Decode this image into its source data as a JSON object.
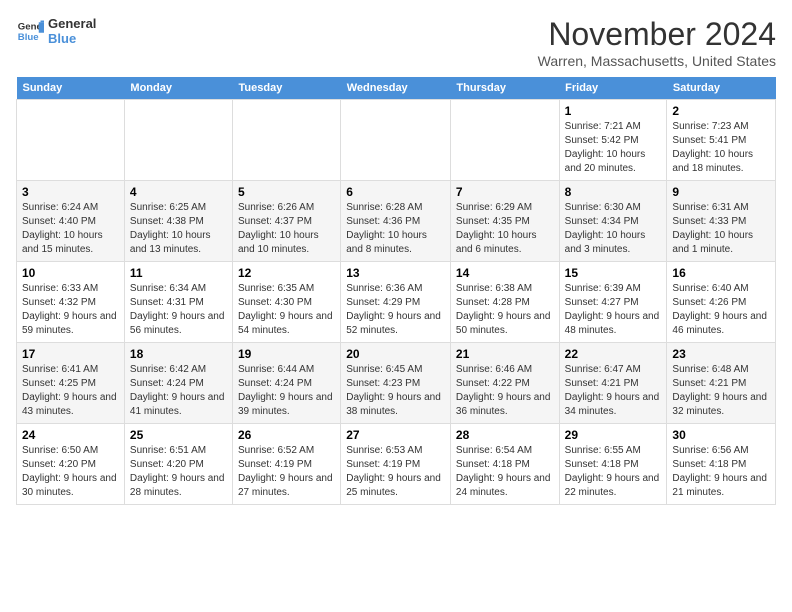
{
  "logo": {
    "line1": "General",
    "line2": "Blue"
  },
  "title": "November 2024",
  "location": "Warren, Massachusetts, United States",
  "days_header": [
    "Sunday",
    "Monday",
    "Tuesday",
    "Wednesday",
    "Thursday",
    "Friday",
    "Saturday"
  ],
  "weeks": [
    [
      {
        "day": "",
        "info": ""
      },
      {
        "day": "",
        "info": ""
      },
      {
        "day": "",
        "info": ""
      },
      {
        "day": "",
        "info": ""
      },
      {
        "day": "",
        "info": ""
      },
      {
        "day": "1",
        "info": "Sunrise: 7:21 AM\nSunset: 5:42 PM\nDaylight: 10 hours and 20 minutes."
      },
      {
        "day": "2",
        "info": "Sunrise: 7:23 AM\nSunset: 5:41 PM\nDaylight: 10 hours and 18 minutes."
      }
    ],
    [
      {
        "day": "3",
        "info": "Sunrise: 6:24 AM\nSunset: 4:40 PM\nDaylight: 10 hours and 15 minutes."
      },
      {
        "day": "4",
        "info": "Sunrise: 6:25 AM\nSunset: 4:38 PM\nDaylight: 10 hours and 13 minutes."
      },
      {
        "day": "5",
        "info": "Sunrise: 6:26 AM\nSunset: 4:37 PM\nDaylight: 10 hours and 10 minutes."
      },
      {
        "day": "6",
        "info": "Sunrise: 6:28 AM\nSunset: 4:36 PM\nDaylight: 10 hours and 8 minutes."
      },
      {
        "day": "7",
        "info": "Sunrise: 6:29 AM\nSunset: 4:35 PM\nDaylight: 10 hours and 6 minutes."
      },
      {
        "day": "8",
        "info": "Sunrise: 6:30 AM\nSunset: 4:34 PM\nDaylight: 10 hours and 3 minutes."
      },
      {
        "day": "9",
        "info": "Sunrise: 6:31 AM\nSunset: 4:33 PM\nDaylight: 10 hours and 1 minute."
      }
    ],
    [
      {
        "day": "10",
        "info": "Sunrise: 6:33 AM\nSunset: 4:32 PM\nDaylight: 9 hours and 59 minutes."
      },
      {
        "day": "11",
        "info": "Sunrise: 6:34 AM\nSunset: 4:31 PM\nDaylight: 9 hours and 56 minutes."
      },
      {
        "day": "12",
        "info": "Sunrise: 6:35 AM\nSunset: 4:30 PM\nDaylight: 9 hours and 54 minutes."
      },
      {
        "day": "13",
        "info": "Sunrise: 6:36 AM\nSunset: 4:29 PM\nDaylight: 9 hours and 52 minutes."
      },
      {
        "day": "14",
        "info": "Sunrise: 6:38 AM\nSunset: 4:28 PM\nDaylight: 9 hours and 50 minutes."
      },
      {
        "day": "15",
        "info": "Sunrise: 6:39 AM\nSunset: 4:27 PM\nDaylight: 9 hours and 48 minutes."
      },
      {
        "day": "16",
        "info": "Sunrise: 6:40 AM\nSunset: 4:26 PM\nDaylight: 9 hours and 46 minutes."
      }
    ],
    [
      {
        "day": "17",
        "info": "Sunrise: 6:41 AM\nSunset: 4:25 PM\nDaylight: 9 hours and 43 minutes."
      },
      {
        "day": "18",
        "info": "Sunrise: 6:42 AM\nSunset: 4:24 PM\nDaylight: 9 hours and 41 minutes."
      },
      {
        "day": "19",
        "info": "Sunrise: 6:44 AM\nSunset: 4:24 PM\nDaylight: 9 hours and 39 minutes."
      },
      {
        "day": "20",
        "info": "Sunrise: 6:45 AM\nSunset: 4:23 PM\nDaylight: 9 hours and 38 minutes."
      },
      {
        "day": "21",
        "info": "Sunrise: 6:46 AM\nSunset: 4:22 PM\nDaylight: 9 hours and 36 minutes."
      },
      {
        "day": "22",
        "info": "Sunrise: 6:47 AM\nSunset: 4:21 PM\nDaylight: 9 hours and 34 minutes."
      },
      {
        "day": "23",
        "info": "Sunrise: 6:48 AM\nSunset: 4:21 PM\nDaylight: 9 hours and 32 minutes."
      }
    ],
    [
      {
        "day": "24",
        "info": "Sunrise: 6:50 AM\nSunset: 4:20 PM\nDaylight: 9 hours and 30 minutes."
      },
      {
        "day": "25",
        "info": "Sunrise: 6:51 AM\nSunset: 4:20 PM\nDaylight: 9 hours and 28 minutes."
      },
      {
        "day": "26",
        "info": "Sunrise: 6:52 AM\nSunset: 4:19 PM\nDaylight: 9 hours and 27 minutes."
      },
      {
        "day": "27",
        "info": "Sunrise: 6:53 AM\nSunset: 4:19 PM\nDaylight: 9 hours and 25 minutes."
      },
      {
        "day": "28",
        "info": "Sunrise: 6:54 AM\nSunset: 4:18 PM\nDaylight: 9 hours and 24 minutes."
      },
      {
        "day": "29",
        "info": "Sunrise: 6:55 AM\nSunset: 4:18 PM\nDaylight: 9 hours and 22 minutes."
      },
      {
        "day": "30",
        "info": "Sunrise: 6:56 AM\nSunset: 4:18 PM\nDaylight: 9 hours and 21 minutes."
      }
    ]
  ]
}
